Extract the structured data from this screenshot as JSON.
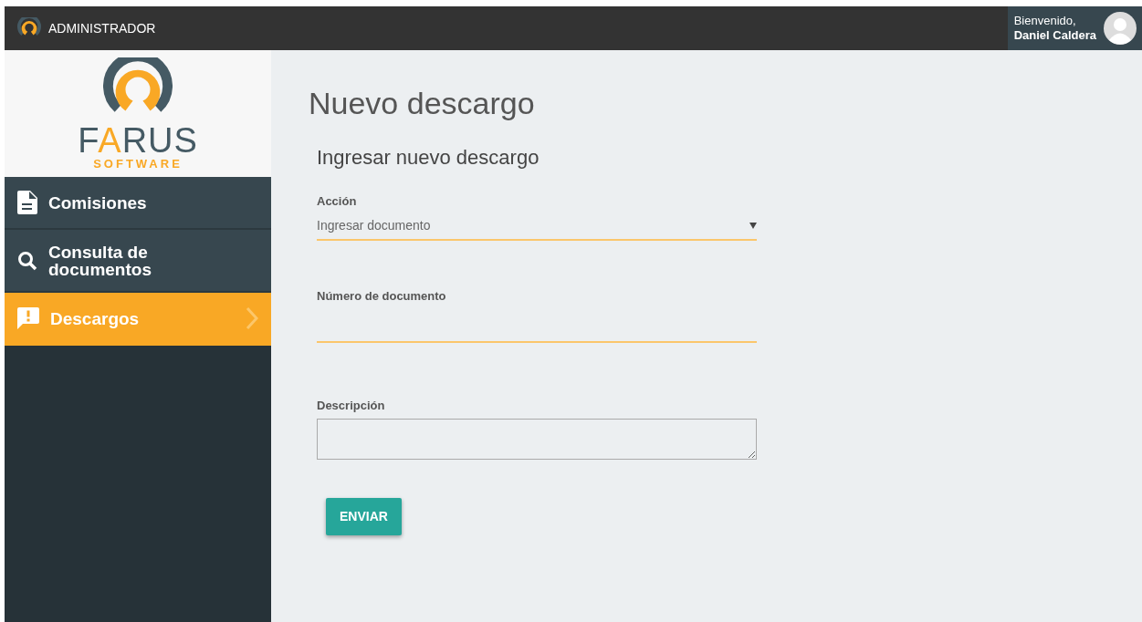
{
  "topbar": {
    "title": "ADMINISTRADOR",
    "welcome": "Bienvenido,",
    "user": "Daniel Caldera"
  },
  "logo": {
    "name_start": "F",
    "name_accent": "A",
    "name_end": "RUS",
    "tagline": "SOFTWARE"
  },
  "sidebar": {
    "items": [
      {
        "label": "Comisiones",
        "kind": "document",
        "selected": false
      },
      {
        "label": "Consulta de documentos",
        "kind": "search",
        "selected": false
      },
      {
        "label": "Descargos",
        "kind": "alert",
        "selected": true
      }
    ]
  },
  "page": {
    "title": "Nuevo descargo",
    "subtitle": "Ingresar nuevo descargo"
  },
  "form": {
    "fields": [
      {
        "kind": "select",
        "label": "Acción",
        "value": "Ingresar documento"
      },
      {
        "kind": "text",
        "label": "Número de documento"
      },
      {
        "kind": "textarea",
        "label": "Descripción"
      }
    ],
    "submit": "ENVIAR"
  }
}
